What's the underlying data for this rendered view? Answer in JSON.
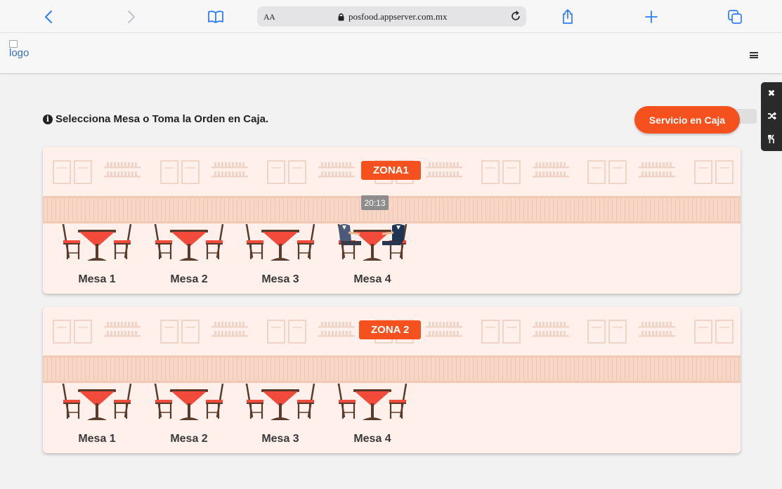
{
  "browser": {
    "aa_label": "AA",
    "url": "posfood.appserver.com.mx"
  },
  "header": {
    "logo_alt": "logo"
  },
  "page": {
    "title": "Selecciona Mesa o Toma la Orden en Caja.",
    "info_glyph": "i",
    "cash_button": "Servicio en Caja"
  },
  "side_panel": {
    "icons": [
      "close-icon",
      "shuffle-icon",
      "utensils-icon"
    ]
  },
  "zones": [
    {
      "name": "ZONA1",
      "tables": [
        {
          "label": "Mesa 1",
          "occupied": false
        },
        {
          "label": "Mesa 2",
          "occupied": false
        },
        {
          "label": "Mesa 3",
          "occupied": false
        },
        {
          "label": "Mesa 4",
          "occupied": true,
          "timer": "20:13"
        }
      ]
    },
    {
      "name": "ZONA 2",
      "tables": [
        {
          "label": "Mesa 1",
          "occupied": false
        },
        {
          "label": "Mesa 2",
          "occupied": false
        },
        {
          "label": "Mesa 3",
          "occupied": false
        },
        {
          "label": "Mesa 4",
          "occupied": false
        }
      ]
    }
  ],
  "colors": {
    "accent": "#f4511e",
    "card_bg": "#fff0eb",
    "table_top": "#f24b3b",
    "furniture": "#5a3a2a"
  }
}
